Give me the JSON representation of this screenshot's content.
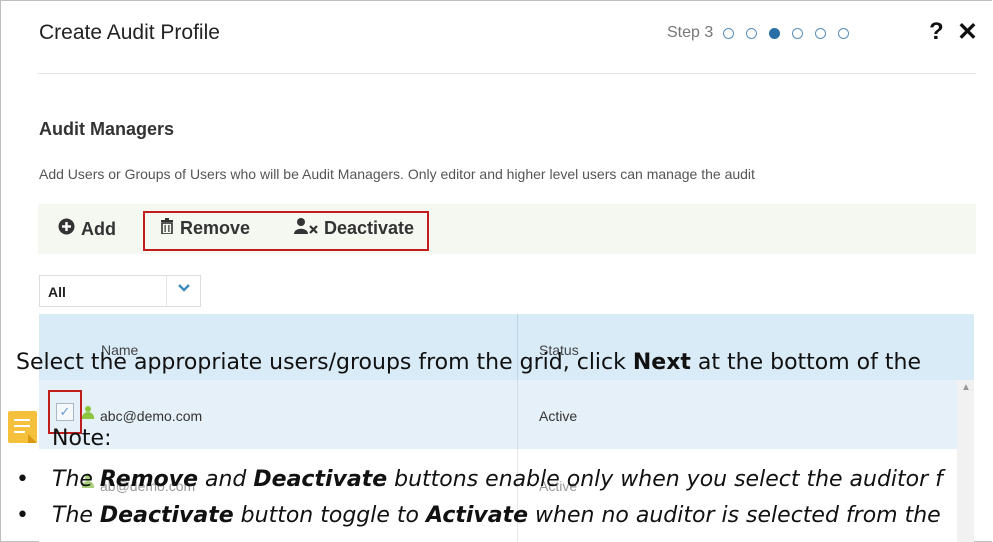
{
  "dialog": {
    "title": "Create Audit Profile",
    "step_label": "Step 3",
    "steps_total": 6,
    "active_step": 3,
    "help": "?",
    "close": "✕"
  },
  "section": {
    "title": "Audit Managers",
    "description": "Add Users or Groups of Users who will be Audit Managers. Only editor and higher level users can manage the audit"
  },
  "toolbar": {
    "add_label": "Add",
    "remove_label": "Remove",
    "deactivate_label": "Deactivate"
  },
  "filter": {
    "selected": "All"
  },
  "grid": {
    "columns": [
      "Name",
      "Status"
    ],
    "rows": [
      {
        "name": "abc@demo.com",
        "status": "Active",
        "selected": true
      },
      {
        "name": "ab@demo.com",
        "status": "Active",
        "selected": false
      }
    ]
  },
  "overlay": {
    "instruction_prefix": "Select the appropriate users/groups from the grid, click ",
    "instruction_bold": "Next",
    "instruction_suffix": " at the bottom of the",
    "note_label": "Note:",
    "bullet1_a": "The ",
    "bullet1_b": "Remove",
    "bullet1_c": " and ",
    "bullet1_d": "Deactivate",
    "bullet1_e": " buttons enable only when you select the auditor f",
    "bullet2_a": "The ",
    "bullet2_b": "Deactivate",
    "bullet2_c": " button toggle to ",
    "bullet2_d": "Activate",
    "bullet2_e": " when no auditor is selected from the",
    "bullet_symbol": "•"
  },
  "colors": {
    "highlight": "#c21d1d",
    "active_step": "#2a6ea6",
    "grid_header": "#d9ebf7",
    "note_icon": "#f5c13c"
  }
}
